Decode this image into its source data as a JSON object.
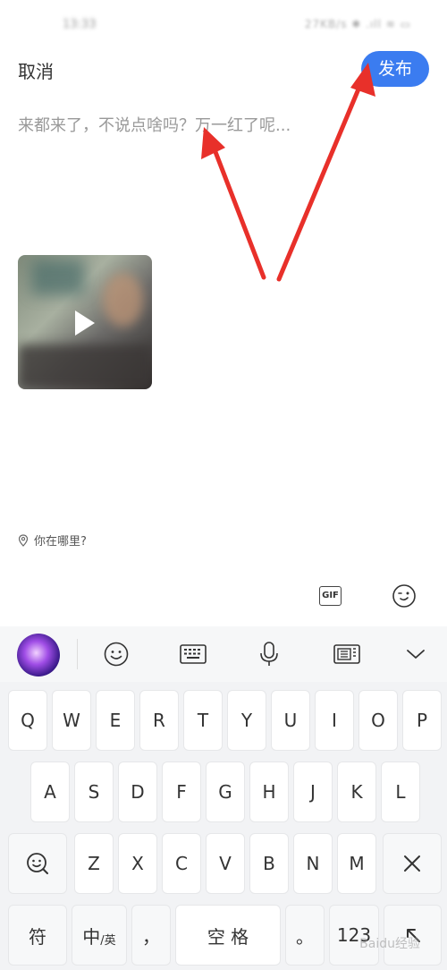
{
  "status_bar": {
    "time": "13:33",
    "right": "27KB/s ✱ .ıll ≋ ▭"
  },
  "header": {
    "cancel_label": "取消",
    "publish_label": "发布"
  },
  "composer": {
    "placeholder": "来都来了，不说点啥吗？万一红了呢..."
  },
  "attachment": {
    "type": "video",
    "icon": "play-icon"
  },
  "location": {
    "label": "你在哪里?",
    "icon": "location-pin-icon"
  },
  "compose_tools": {
    "gif_label": "GIF",
    "emoji_icon": "wink-emoji-icon"
  },
  "keyboard_toolbar": {
    "items": [
      "avatar",
      "emoji-icon",
      "keyboard-icon",
      "microphone-icon",
      "clipboard-icon",
      "chevron-down-icon"
    ]
  },
  "keyboard": {
    "row1": [
      "Q",
      "W",
      "E",
      "R",
      "T",
      "Y",
      "U",
      "I",
      "O",
      "P"
    ],
    "row2": [
      "A",
      "S",
      "D",
      "F",
      "G",
      "H",
      "J",
      "K",
      "L"
    ],
    "row3": [
      "Z",
      "X",
      "C",
      "V",
      "B",
      "N",
      "M"
    ],
    "symbol_label": "符",
    "lang_label_main": "中",
    "lang_label_sub": "/英",
    "comma_label": "，",
    "space_label": "空 格",
    "period_label": "。",
    "num_label": "123",
    "enter_icon": "enter-icon",
    "delete_icon": "delete-icon",
    "search_icon": "search-face-icon"
  },
  "watermark": "Baidu经验"
}
